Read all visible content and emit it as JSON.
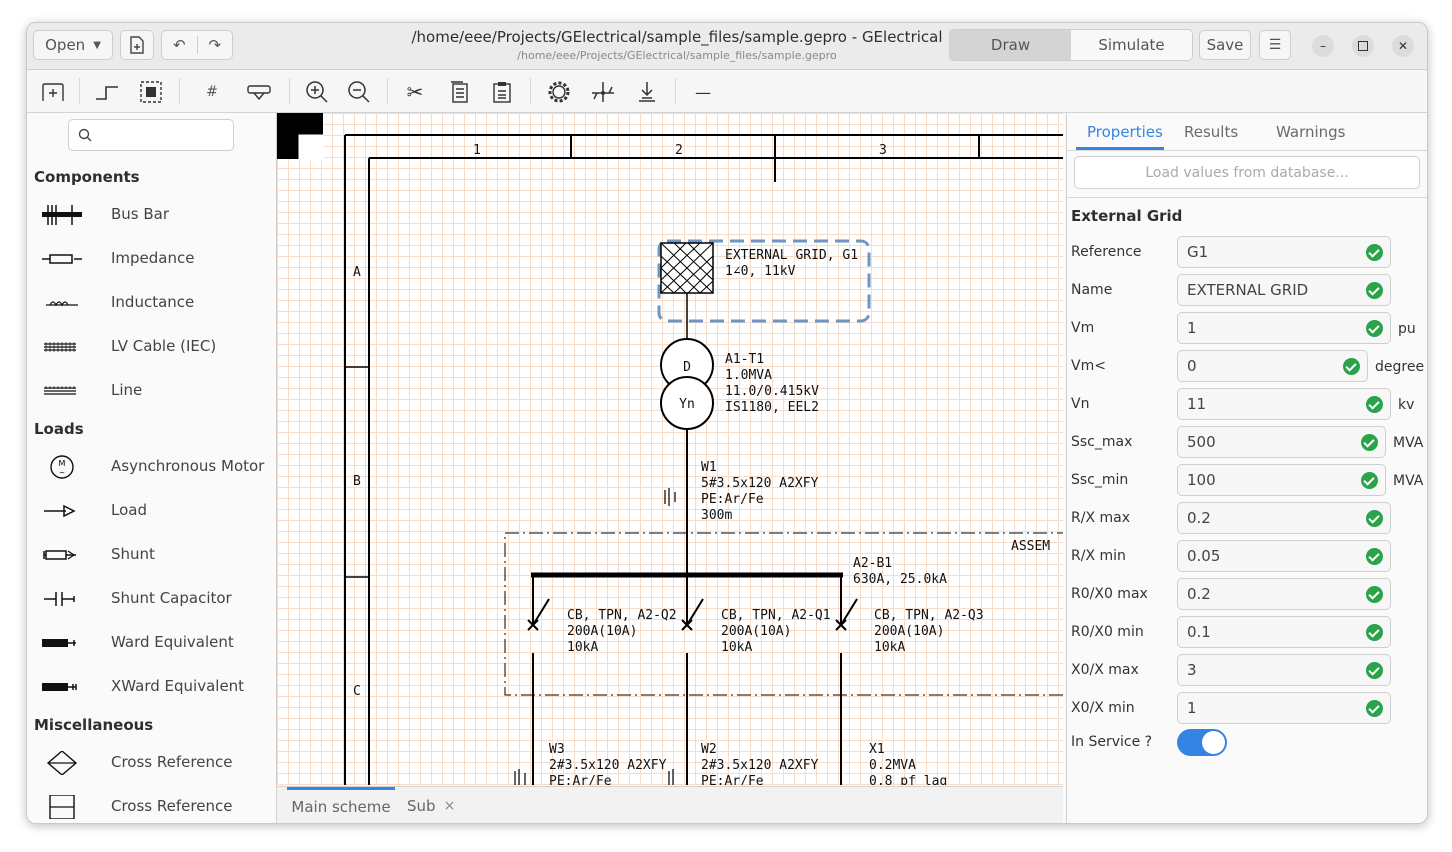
{
  "header": {
    "open_label": "Open",
    "title": "/home/eee/Projects/GElectrical/sample_files/sample.gepro - GElectrical",
    "subtitle": "/home/eee/Projects/GElectrical/sample_files/sample.gepro",
    "mode_draw": "Draw",
    "mode_simulate": "Simulate",
    "save_label": "Save"
  },
  "toolbar": {
    "icons": [
      "add-page-icon",
      "wire-icon",
      "select-icon",
      "grid-icon",
      "link-icon",
      "zoom-in-icon",
      "zoom-out-icon",
      "cut-icon",
      "copy-icon",
      "paste-icon",
      "settings-icon",
      "network-icon",
      "export-icon",
      "minimize-panel-icon"
    ]
  },
  "sidebar": {
    "search_placeholder": "",
    "sections": [
      {
        "title": "Components",
        "items": [
          "Bus Bar",
          "Impedance",
          "Inductance",
          "LV Cable (IEC)",
          "Line"
        ]
      },
      {
        "title": "Loads",
        "items": [
          "Asynchronous Motor",
          "Load",
          "Shunt",
          "Shunt Capacitor",
          "Ward Equivalent",
          "XWard Equivalent"
        ]
      },
      {
        "title": "Miscellaneous",
        "items": [
          "Cross Reference",
          "Cross Reference"
        ]
      }
    ]
  },
  "schematic": {
    "columns": [
      "1",
      "2",
      "3"
    ],
    "rows": [
      "A",
      "B",
      "C"
    ],
    "grid_label_1": "EXTERNAL GRID, G1",
    "grid_label_2": "1∠0, 11kV",
    "tx_ref": "A1-T1",
    "tx_rating": "1.0MVA",
    "tx_voltage": "11.0/0.415kV",
    "tx_std": "IS1180, EEL2",
    "tx_primary": "D",
    "tx_secondary": "Yn",
    "w1_ref": "W1",
    "w1_spec": "5#3.5x120 A2XFY",
    "w1_pe": "PE:Ar/Fe",
    "w1_len": "300m",
    "assembly_label": "ASSEM",
    "bus_ref": "A2-B1",
    "bus_rating": "630A, 25.0kA",
    "cb1_name": "CB, TPN, A2-Q2",
    "cb1_rating": "200A(10A)",
    "cb1_break": "10kA",
    "cb2_name": "CB, TPN, A2-Q1",
    "cb2_rating": "200A(10A)",
    "cb2_break": "10kA",
    "cb3_name": "CB, TPN, A2-Q3",
    "cb3_rating": "200A(10A)",
    "cb3_break": "10kA",
    "w3_ref": "W3",
    "w3_spec": "2#3.5x120 A2XFY",
    "w3_pe": "PE:Ar/Fe",
    "w2_ref": "W2",
    "w2_spec": "2#3.5x120 A2XFY",
    "w2_pe": "PE:Ar/Fe",
    "x1_ref": "X1",
    "x1_rating": "0.2MVA",
    "x1_pf": "0.8 pf lag"
  },
  "bottom_tabs": {
    "main": "Main scheme",
    "sub": "Sub",
    "close": "×"
  },
  "properties": {
    "tabs": [
      "Properties",
      "Results",
      "Warnings"
    ],
    "load_button": "Load values from database...",
    "heading": "External Grid",
    "fields": [
      {
        "label": "Reference",
        "value": "G1",
        "unit": ""
      },
      {
        "label": "Name",
        "value": "EXTERNAL GRID",
        "unit": ""
      },
      {
        "label": "Vm",
        "value": "1",
        "unit": "pu"
      },
      {
        "label": "Vm<",
        "value": "0",
        "unit": "degree"
      },
      {
        "label": "Vn",
        "value": "11",
        "unit": "kv"
      },
      {
        "label": "Ssc_max",
        "value": "500",
        "unit": "MVA"
      },
      {
        "label": "Ssc_min",
        "value": "100",
        "unit": "MVA"
      },
      {
        "label": "R/X max",
        "value": "0.2",
        "unit": ""
      },
      {
        "label": "R/X min",
        "value": "0.05",
        "unit": ""
      },
      {
        "label": "R0/X0 max",
        "value": "0.2",
        "unit": ""
      },
      {
        "label": "R0/X0 min",
        "value": "0.1",
        "unit": ""
      },
      {
        "label": "X0/X max",
        "value": "3",
        "unit": ""
      },
      {
        "label": "X0/X min",
        "value": "1",
        "unit": ""
      }
    ],
    "in_service_label": "In Service ?",
    "in_service": true,
    "accent": "#3584e4"
  }
}
